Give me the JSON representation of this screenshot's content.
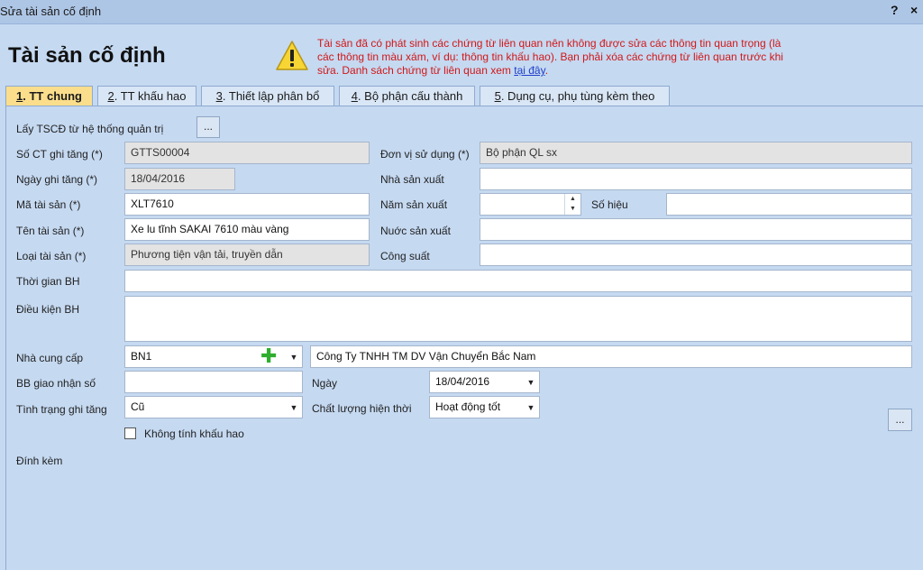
{
  "window": {
    "title": "Sửa tài sản cố định",
    "help": "?",
    "close": "×"
  },
  "heading": "Tài sản cố định",
  "warning": {
    "text": "Tài sản đã có phát sinh các chứng từ liên quan nên không được sửa các thông tin quan trọng (là các thông tin màu xám, ví dụ: thông tin khấu hao). Bạn phải xóa các chứng từ liên quan trước khi sửa. Danh sách chứng từ liên quan xem",
    "link": "tại đây",
    "end": ".",
    "icon": "warning-icon",
    "colors": {
      "text": "#d01818",
      "link": "#1f3ec9"
    }
  },
  "tabs": [
    {
      "num": "1",
      "label": ". TT chung"
    },
    {
      "num": "2",
      "label": ". TT khấu hao"
    },
    {
      "num": "3",
      "label": ". Thiết lập phân bổ"
    },
    {
      "num": "4",
      "label": ". Bộ phận cấu thành"
    },
    {
      "num": "5",
      "label": ". Dụng cụ, phụ tùng kèm theo"
    }
  ],
  "form": {
    "lay_tscd_label": "Lấy TSCĐ từ hệ thống quản trị",
    "lay_tscd_btn": "...",
    "so_ct_label": "Số CT ghi tăng (*)",
    "so_ct_value": "GTTS00004",
    "ngay_ghi_tang_label": "Ngày ghi tăng (*)",
    "ngay_ghi_tang_value": "18/04/2016",
    "ma_ts_label": "Mã tài sản (*)",
    "ma_ts_value": "XLT7610",
    "ten_ts_label": "Tên tài sản (*)",
    "ten_ts_value": "Xe lu tĩnh SAKAI 7610 màu vàng",
    "loai_ts_label": "Loại tài sản (*)",
    "loai_ts_value": "Phương tiện vận tải, truyền dẫn",
    "thoi_gian_bh_label": "Thời gian BH",
    "thoi_gian_bh_value": "",
    "dieu_kien_bh_label": "Điều kiện BH",
    "dieu_kien_bh_value": "",
    "don_vi_label": "Đơn vị sử dụng (*)",
    "don_vi_value": "Bộ phận QL sx",
    "nha_sx_label": "Nhà sản xuất",
    "nha_sx_value": "",
    "nam_sx_label": "Năm sản xuất",
    "nam_sx_value": "",
    "so_hieu_label": "Số hiệu",
    "so_hieu_value": "",
    "nuoc_sx_label": "Nuớc sản xuất",
    "nuoc_sx_value": "",
    "cong_suat_label": "Công suất",
    "cong_suat_value": "",
    "nha_cc_label": "Nhà cung cấp",
    "nha_cc_code": "BN1",
    "nha_cc_name": "Công Ty TNHH TM DV Vận Chuyển Bắc Nam",
    "bb_giao_nhan_label": "BB giao nhận số",
    "bb_giao_nhan_value": "",
    "ngay_label": "Ngày",
    "ngay_value": "18/04/2016",
    "tinh_trang_label": "Tình trạng ghi tăng",
    "tinh_trang_value": "Cũ",
    "chat_luong_label": "Chất lượng hiện thời",
    "chat_luong_value": "Hoạt động tốt",
    "khong_tinh_kh_label": "Không tính khấu hao",
    "khong_tinh_kh_checked": false,
    "dinh_kem_label": "Đính kèm",
    "dinh_kem_btn": "..."
  }
}
